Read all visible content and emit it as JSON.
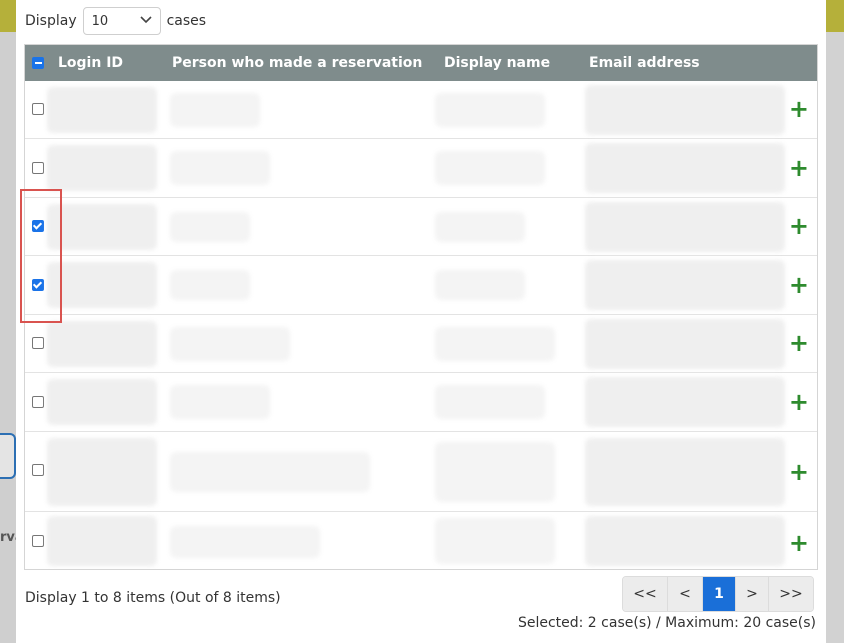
{
  "length_control": {
    "prefix": "Display",
    "value": "10",
    "suffix": "cases"
  },
  "table": {
    "columns": [
      "Login ID",
      "Person who made a reservation",
      "Display name",
      "Email address"
    ],
    "rows": [
      {
        "checked": false
      },
      {
        "checked": false
      },
      {
        "checked": true
      },
      {
        "checked": true
      },
      {
        "checked": false
      },
      {
        "checked": false
      },
      {
        "checked": false
      },
      {
        "checked": false
      }
    ],
    "add_symbol": "+"
  },
  "footer": {
    "info": "Display 1 to 8 items (Out of 8 items)",
    "pagination": [
      "<<",
      "<",
      "1",
      ">",
      ">>"
    ],
    "active_page": "1",
    "selected": "Selected: 2 case(s) / Maximum: 20 case(s)"
  },
  "background": {
    "fragment_text": "rva"
  },
  "colors": {
    "header_bg": "#7f8c8c",
    "checkbox_accent": "#1a73e8",
    "add_icon": "#2e8b2e",
    "highlight_border": "#d9534f",
    "active_page_bg": "#1a6fd8"
  }
}
